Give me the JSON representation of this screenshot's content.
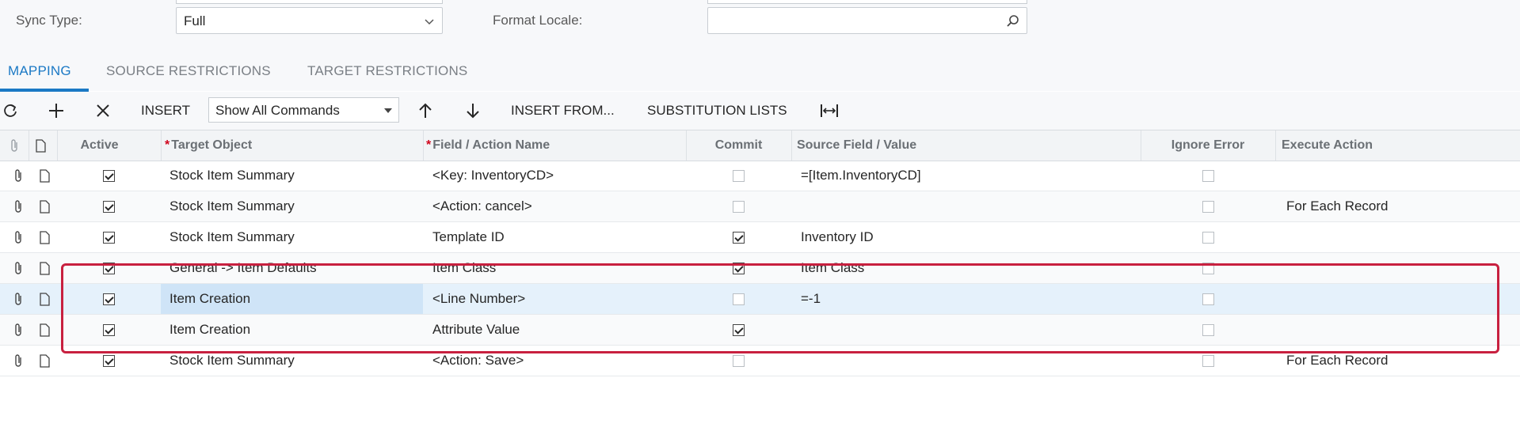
{
  "form": {
    "sync_type_label": "Sync Type:",
    "sync_type_value": "Full",
    "format_locale_label": "Format Locale:",
    "format_locale_value": ""
  },
  "tabs": [
    {
      "label": "MAPPING",
      "active": true
    },
    {
      "label": "SOURCE RESTRICTIONS",
      "active": false
    },
    {
      "label": "TARGET RESTRICTIONS",
      "active": false
    }
  ],
  "toolbar": {
    "insert_label": "INSERT",
    "command_filter_value": "Show All Commands",
    "insert_from_label": "INSERT FROM...",
    "substitution_lists_label": "SUBSTITUTION LISTS"
  },
  "grid": {
    "columns": {
      "active": "Active",
      "target_object": "Target Object",
      "field_action": "Field / Action Name",
      "commit": "Commit",
      "source_field": "Source Field / Value",
      "ignore_error": "Ignore Error",
      "execute_action": "Execute Action"
    },
    "rows": [
      {
        "active": true,
        "target_object": "Stock Item Summary",
        "field_action": "<Key: InventoryCD>",
        "commit": false,
        "source_field": "=[Item.InventoryCD]",
        "ignore_error": false,
        "execute_action": ""
      },
      {
        "active": true,
        "target_object": "Stock Item Summary",
        "field_action": "<Action: cancel>",
        "commit": false,
        "source_field": "",
        "ignore_error": false,
        "execute_action": "For Each Record"
      },
      {
        "active": true,
        "target_object": "Stock Item Summary",
        "field_action": "Template ID",
        "commit": true,
        "source_field": "Inventory ID",
        "ignore_error": false,
        "execute_action": ""
      },
      {
        "active": true,
        "target_object": "General -> Item Defaults",
        "field_action": "Item Class",
        "commit": true,
        "source_field": "Item Class",
        "ignore_error": false,
        "execute_action": ""
      },
      {
        "active": true,
        "target_object": "Item Creation",
        "field_action": "<Line Number>",
        "commit": false,
        "source_field": "=-1",
        "ignore_error": false,
        "execute_action": ""
      },
      {
        "active": true,
        "target_object": "Item Creation",
        "field_action": "Attribute Value",
        "commit": true,
        "source_field": "",
        "ignore_error": false,
        "execute_action": ""
      },
      {
        "active": true,
        "target_object": "Stock Item Summary",
        "field_action": "<Action: Save>",
        "commit": false,
        "source_field": "",
        "ignore_error": false,
        "execute_action": "For Each Record"
      }
    ]
  },
  "colors": {
    "accent": "#1b79c5",
    "highlight": "#c8203f",
    "required_marker": "#d0021b",
    "selected_row": "#e5f1fb"
  }
}
